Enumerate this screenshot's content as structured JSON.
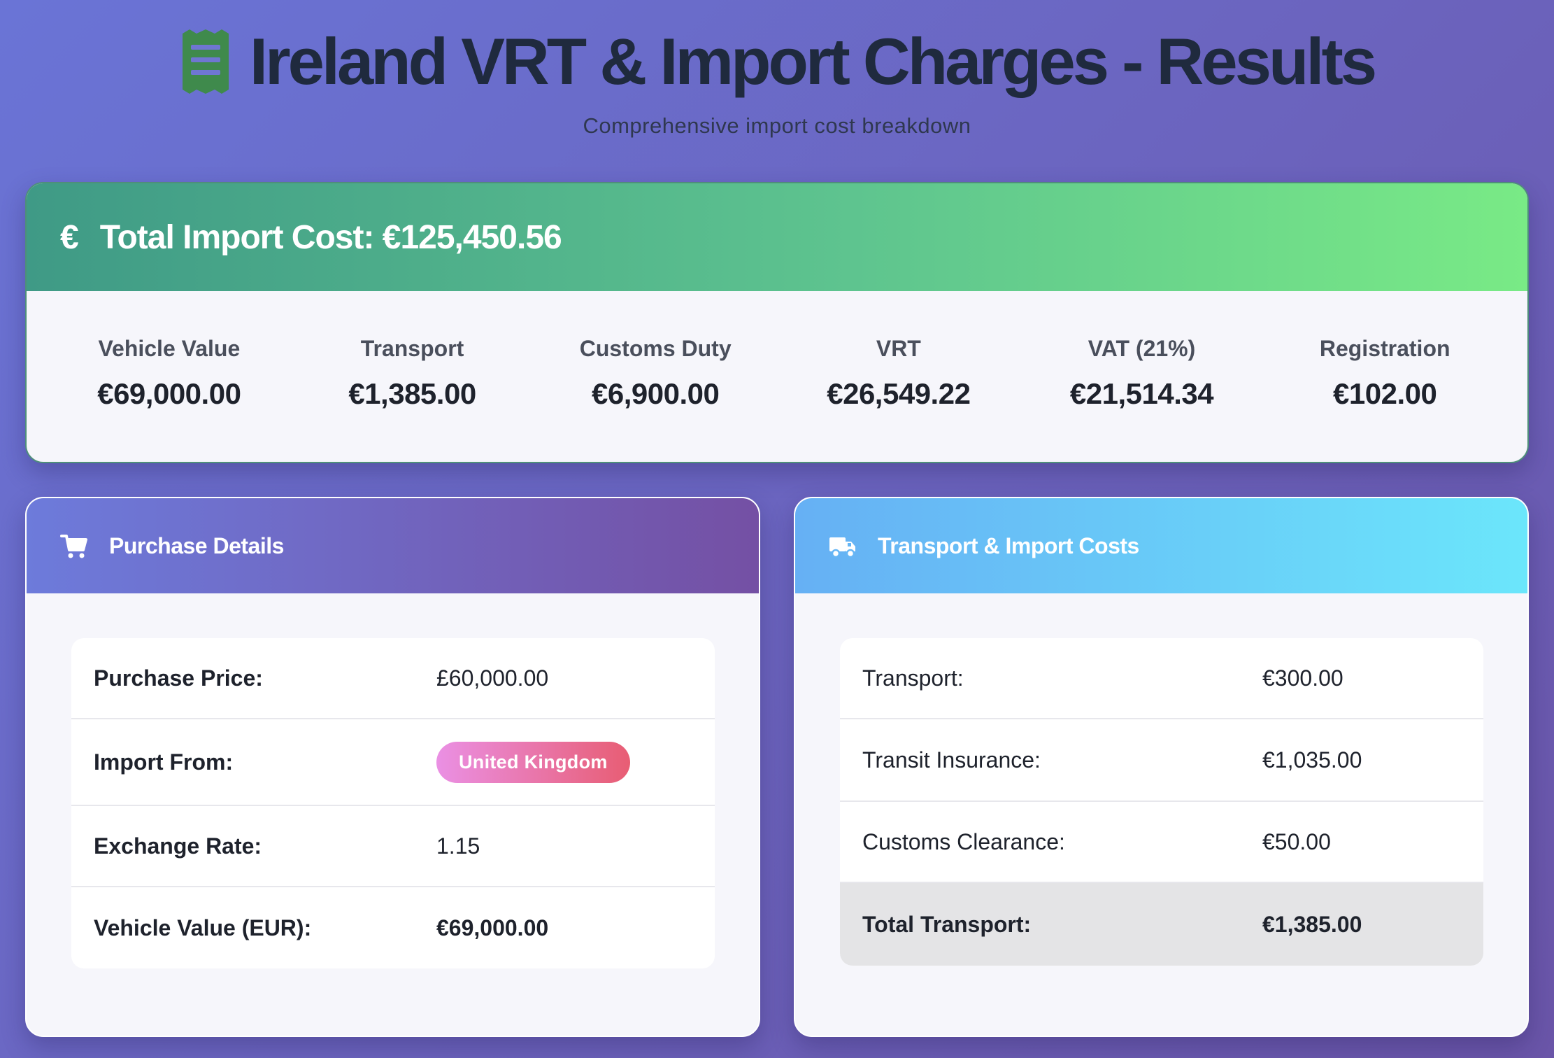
{
  "header": {
    "title": "Ireland VRT & Import Charges - Results",
    "subtitle": "Comprehensive import cost breakdown",
    "icon": "receipt-icon"
  },
  "summary": {
    "icon": "euro-icon",
    "title": "Total Import Cost: €125,450.56",
    "items": [
      {
        "label": "Vehicle Value",
        "value": "€69,000.00"
      },
      {
        "label": "Transport",
        "value": "€1,385.00"
      },
      {
        "label": "Customs Duty",
        "value": "€6,900.00"
      },
      {
        "label": "VRT",
        "value": "€26,549.22"
      },
      {
        "label": "VAT (21%)",
        "value": "€21,514.34"
      },
      {
        "label": "Registration",
        "value": "€102.00"
      }
    ]
  },
  "purchase": {
    "icon": "shopping-cart-icon",
    "title": "Purchase Details",
    "rows": [
      {
        "label": "Purchase Price:",
        "value": "£60,000.00"
      },
      {
        "label": "Import From:",
        "value": "United Kingdom"
      },
      {
        "label": "Exchange Rate:",
        "value": "1.15"
      },
      {
        "label": "Vehicle Value (EUR):",
        "value": "€69,000.00"
      }
    ]
  },
  "transport": {
    "icon": "truck-icon",
    "title": "Transport & Import Costs",
    "rows": [
      {
        "label": "Transport:",
        "value": "€300.00"
      },
      {
        "label": "Transit Insurance:",
        "value": "€1,035.00"
      },
      {
        "label": "Customs Clearance:",
        "value": "€50.00"
      },
      {
        "label": "Total Transport:",
        "value": "€1,385.00"
      }
    ]
  },
  "colors": {
    "accent_green": "#5ec48f",
    "accent_purple": "#7450a4",
    "accent_blue": "#66b0f4",
    "badge_pink": "#e85d73"
  }
}
